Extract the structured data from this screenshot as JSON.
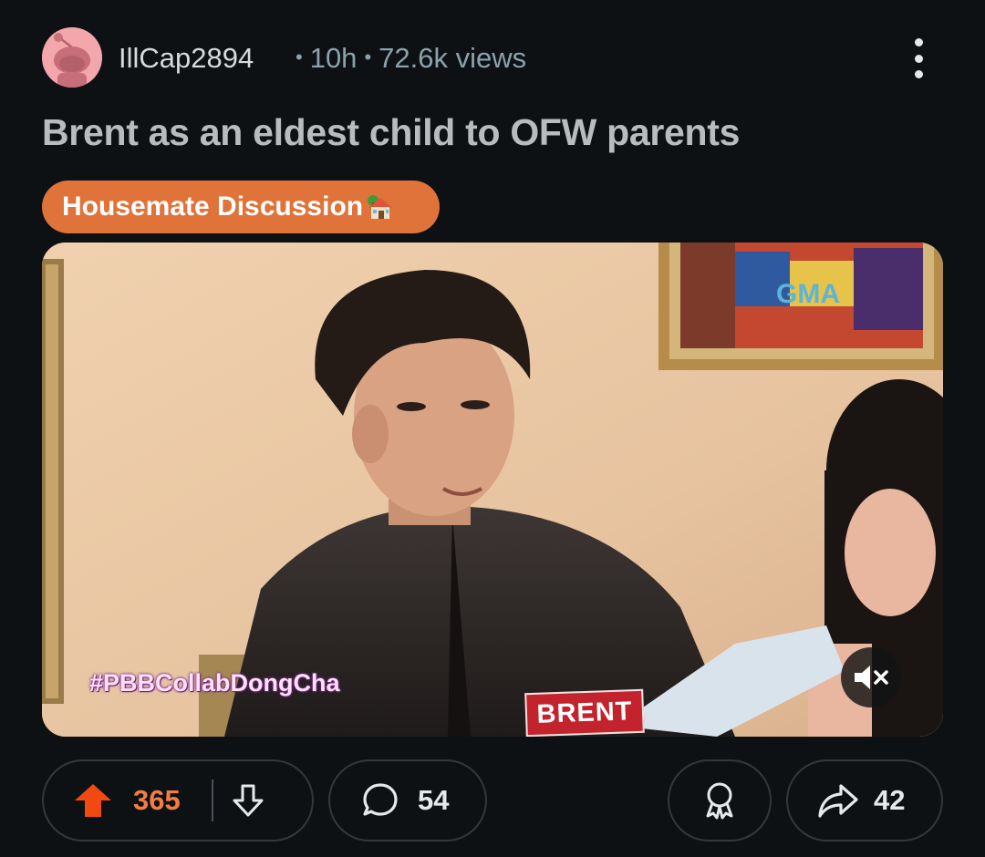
{
  "post": {
    "author": "IllCap2894",
    "age": "10h",
    "views": "72.6k views",
    "title": "Brent as an eldest child to OFW parents",
    "flair": "Housemate Discussion",
    "flair_icon": "house-emoji",
    "flair_color": "#e0733a"
  },
  "video": {
    "hashtag": "#PBBCollabDongCha",
    "name_tag": "BRENT",
    "watermark": "GMA",
    "muted": true
  },
  "actions": {
    "score": "365",
    "comments": "54",
    "shares": "42",
    "upvote_color": "#f04a12"
  },
  "colors": {
    "background": "#0e1113",
    "meta": "#8ba2ad",
    "avatar": "#f4a6ad"
  }
}
